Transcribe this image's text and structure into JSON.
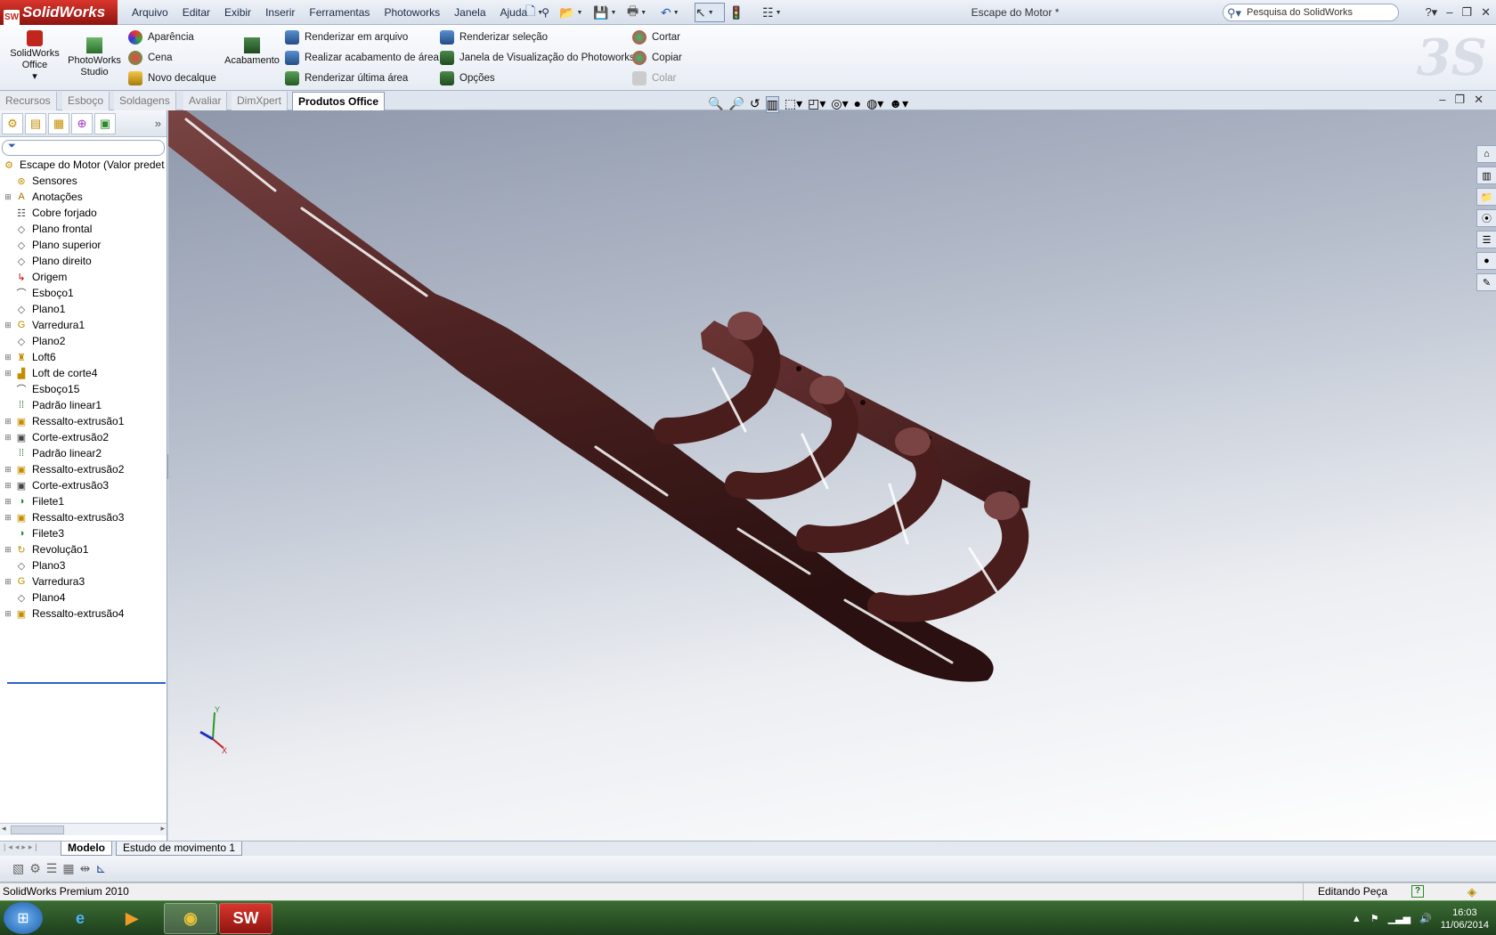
{
  "app": {
    "brand": "SolidWorks",
    "document_title": "Escape do Motor *",
    "search_placeholder": "Pesquisa do SolidWorks"
  },
  "menu": [
    "Arquivo",
    "Editar",
    "Exibir",
    "Inserir",
    "Ferramentas",
    "Photoworks",
    "Janela",
    "Ajuda"
  ],
  "command_manager": {
    "big": [
      {
        "label_1": "SolidWorks",
        "label_2": "Office"
      },
      {
        "label_1": "PhotoWorks",
        "label_2": "Studio"
      },
      {
        "label": "Acabamento"
      }
    ],
    "col1": [
      "Aparência",
      "Cena",
      "Novo decalque"
    ],
    "col2": [
      "Renderizar em arquivo",
      "Realizar acabamento de área",
      "Renderizar última área"
    ],
    "col3": [
      "Renderizar seleção",
      "Janela de Visualização do Photoworks",
      "Opções"
    ],
    "col4": [
      "Cortar",
      "Copiar",
      "Colar"
    ]
  },
  "tabs": [
    "Recursos",
    "Esboço",
    "Soldagens",
    "Avaliar",
    "DimXpert",
    "Produtos Office"
  ],
  "tree": {
    "root": "Escape do Motor  (Valor predet",
    "items": [
      {
        "label": "Sensores",
        "icon": "sensor-icon",
        "exp": false
      },
      {
        "label": "Anotações",
        "icon": "annotation-icon",
        "exp": true
      },
      {
        "label": "Cobre forjado",
        "icon": "material-icon",
        "exp": false
      },
      {
        "label": "Plano frontal",
        "icon": "plane-icon",
        "exp": false
      },
      {
        "label": "Plano superior",
        "icon": "plane-icon",
        "exp": false
      },
      {
        "label": "Plano direito",
        "icon": "plane-icon",
        "exp": false
      },
      {
        "label": "Origem",
        "icon": "origin-icon",
        "exp": false
      },
      {
        "label": "Esboço1",
        "icon": "sketch-icon",
        "exp": false
      },
      {
        "label": "Plano1",
        "icon": "plane-icon",
        "exp": false
      },
      {
        "label": "Varredura1",
        "icon": "sweep-icon",
        "exp": true
      },
      {
        "label": "Plano2",
        "icon": "plane-icon",
        "exp": false
      },
      {
        "label": "Loft6",
        "icon": "loft-icon",
        "exp": true
      },
      {
        "label": "Loft de corte4",
        "icon": "cut-loft-icon",
        "exp": true
      },
      {
        "label": "Esboço15",
        "icon": "sketch-icon",
        "exp": false
      },
      {
        "label": "Padrão linear1",
        "icon": "pattern-icon",
        "exp": false
      },
      {
        "label": "Ressalto-extrusão1",
        "icon": "extrude-icon",
        "exp": true
      },
      {
        "label": "Corte-extrusão2",
        "icon": "cut-extrude-icon",
        "exp": true
      },
      {
        "label": "Padrão linear2",
        "icon": "pattern-icon",
        "exp": false
      },
      {
        "label": "Ressalto-extrusão2",
        "icon": "extrude-icon",
        "exp": true
      },
      {
        "label": "Corte-extrusão3",
        "icon": "cut-extrude-icon",
        "exp": true
      },
      {
        "label": "Filete1",
        "icon": "fillet-icon",
        "exp": true
      },
      {
        "label": "Ressalto-extrusão3",
        "icon": "extrude-icon",
        "exp": true
      },
      {
        "label": "Filete3",
        "icon": "fillet-icon",
        "exp": false
      },
      {
        "label": "Revolução1",
        "icon": "revolve-icon",
        "exp": true
      },
      {
        "label": "Plano3",
        "icon": "plane-icon",
        "exp": false
      },
      {
        "label": "Varredura3",
        "icon": "sweep-icon",
        "exp": true
      },
      {
        "label": "Plano4",
        "icon": "plane-icon",
        "exp": false
      },
      {
        "label": "Ressalto-extrusão4",
        "icon": "extrude-icon",
        "exp": true
      }
    ]
  },
  "triad": {
    "x": "X",
    "y": "Y"
  },
  "bottom_tabs": [
    "Modelo",
    "Estudo de movimento 1"
  ],
  "status": {
    "app": "SolidWorks Premium 2010",
    "mode": "Editando Peça"
  },
  "clock": {
    "time": "16:03",
    "date": "11/06/2014"
  },
  "colors": {
    "model": "#5a2a2a",
    "highlight": "#2b63c7"
  }
}
